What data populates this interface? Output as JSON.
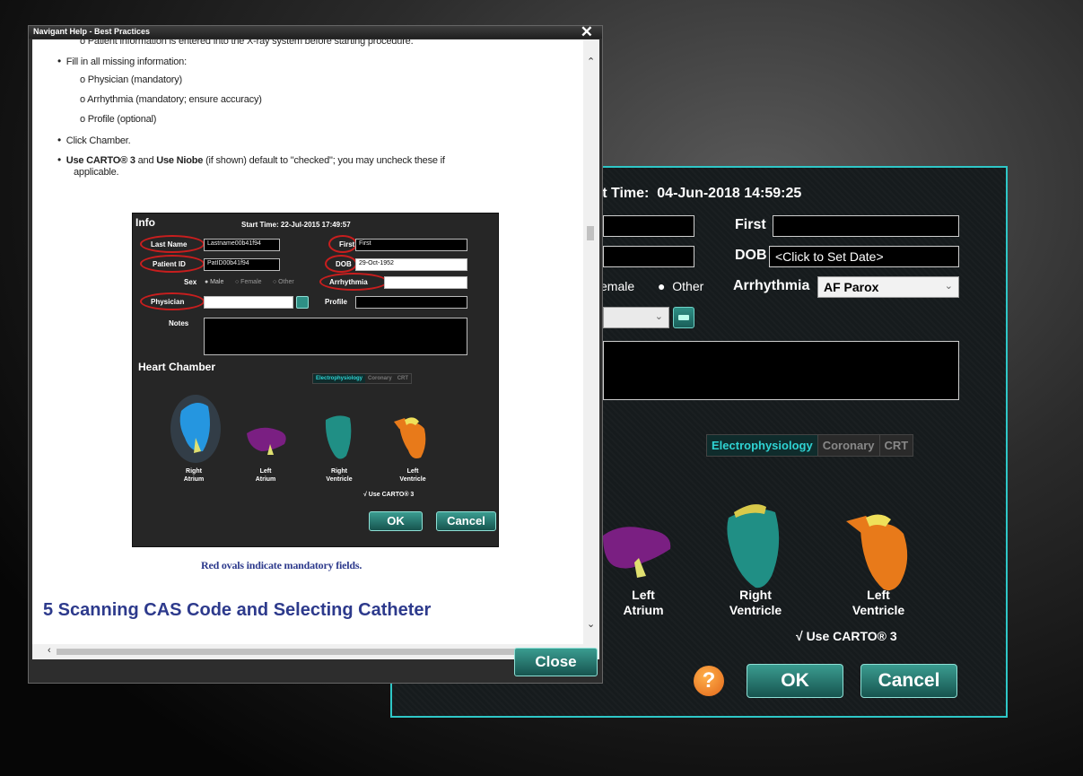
{
  "back_dialog": {
    "start_time_label": "rt Time:",
    "start_time_value": "04-Jun-2018 14:59:25",
    "first_label": "First",
    "dob_label": "DOB",
    "dob_value": "<Click to Set Date>",
    "sex_partial": "emale",
    "other_label": "Other",
    "arrhythmia_label": "Arrhythmia",
    "arrhythmia_value": "AF Parox",
    "tabs": [
      "Electrophysiology",
      "Coronary",
      "CRT"
    ],
    "chambers": [
      {
        "line1": "Left",
        "line2": "Atrium"
      },
      {
        "line1": "Right",
        "line2": "Ventricle"
      },
      {
        "line1": "Left",
        "line2": "Ventricle"
      }
    ],
    "use_carto_label": "√  Use CARTO® 3",
    "ok_label": "OK",
    "cancel_label": "Cancel",
    "help_glyph": "?"
  },
  "help_window": {
    "title": "Navigant Help - Best Practices",
    "close_glyph": "✕",
    "lines": {
      "l0": "o  Patient information is entered into the X-ray system before starting procedure.",
      "l1": "Fill in all missing information:",
      "l2": "o  Physician (mandatory)",
      "l3": "o  Arrhythmia (mandatory; ensure accuracy)",
      "l4": "o  Profile (optional)",
      "l5": "Click Chamber.",
      "l6a": "Use CARTO® 3",
      "l6b": " and ",
      "l6c": "Use Niobe",
      "l6d": " (if shown) default to \"checked\"; you may uncheck these if",
      "l7": "applicable."
    },
    "caption": "Red ovals indicate mandatory fields.",
    "section_heading": "5  Scanning CAS Code and Selecting Catheter",
    "close_button": "Close",
    "embedded": {
      "info_title": "Info",
      "start_time": "Start Time:  22-Jul-2015 17:49:57",
      "last_name_label": "Last Name",
      "last_name_value": "Lastname00b41f94",
      "first_label": "First",
      "first_value": "First",
      "patient_id_label": "Patient ID",
      "patient_id_value": "PatID00b41f94",
      "dob_label": "DOB",
      "dob_value": "29-Oct-1952",
      "sex_label": "Sex",
      "sex_male": "● Male",
      "sex_female": "○ Female",
      "sex_other": "○ Other",
      "arrhythmia_label": "Arrhythmia",
      "physician_label": "Physician",
      "profile_label": "Profile",
      "notes_label": "Notes",
      "heart_chamber_title": "Heart Chamber",
      "tabs": [
        "Electrophysiology",
        "Coronary",
        "CRT"
      ],
      "chambers": [
        {
          "line1": "Right",
          "line2": "Atrium"
        },
        {
          "line1": "Left",
          "line2": "Atrium"
        },
        {
          "line1": "Right",
          "line2": "Ventricle"
        },
        {
          "line1": "Left",
          "line2": "Ventricle"
        }
      ],
      "use_carto": "√  Use CARTO® 3",
      "ok_label": "OK",
      "cancel_label": "Cancel"
    }
  },
  "colors": {
    "teal_accent": "#2ec7c7",
    "button_teal": "#2e8f85",
    "oval_red": "#c81e1e",
    "heading_blue": "#2d3a8c"
  }
}
